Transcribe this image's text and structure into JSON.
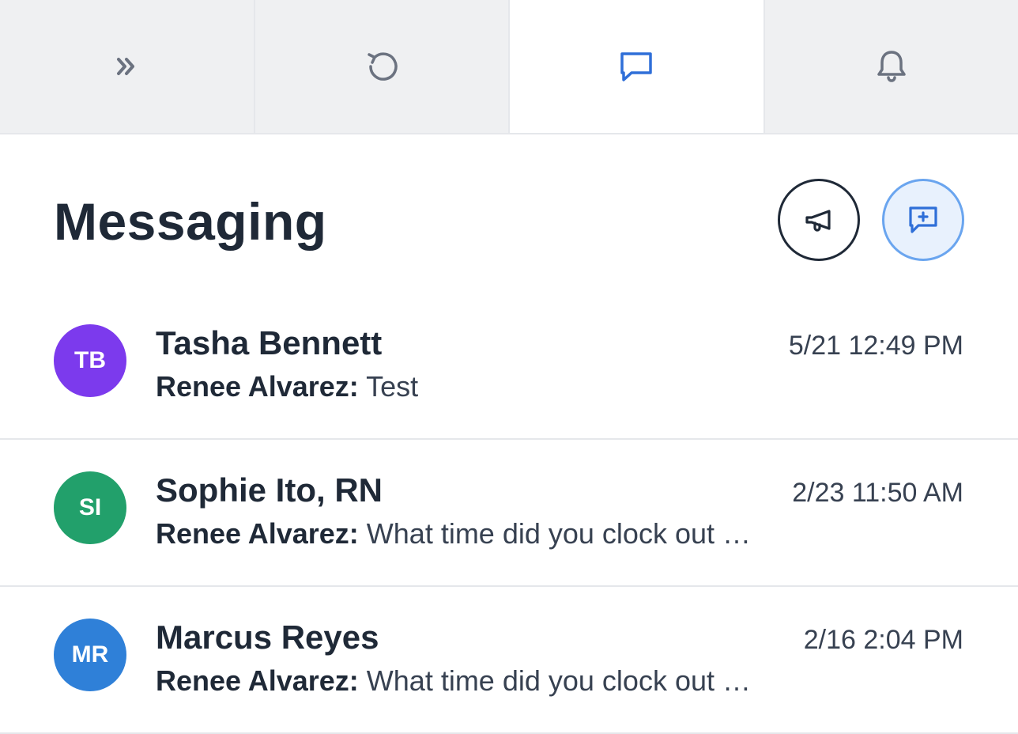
{
  "tabs": [
    {
      "icon": "chevrons-right-icon",
      "active": false
    },
    {
      "icon": "history-icon",
      "active": false
    },
    {
      "icon": "message-icon",
      "active": true
    },
    {
      "icon": "bell-icon",
      "active": false
    }
  ],
  "header": {
    "title": "Messaging"
  },
  "conversations": [
    {
      "initials": "TB",
      "avatar_color": "#7c3aed",
      "name": "Tasha Bennett",
      "time": "5/21 12:49 PM",
      "sender": "Renee Alvarez:",
      "message": "Test"
    },
    {
      "initials": "SI",
      "avatar_color": "#22a06b",
      "name": "Sophie Ito, RN",
      "time": "2/23 11:50 AM",
      "sender": "Renee Alvarez:",
      "message": "What time did you clock out …"
    },
    {
      "initials": "MR",
      "avatar_color": "#2f80d8",
      "name": "Marcus Reyes",
      "time": "2/16 2:04 PM",
      "sender": "Renee Alvarez:",
      "message": "What time did you clock out …"
    }
  ],
  "colors": {
    "accent": "#2f6fd8",
    "icon_gray": "#6b7280",
    "tab_bg": "#eff0f2"
  }
}
